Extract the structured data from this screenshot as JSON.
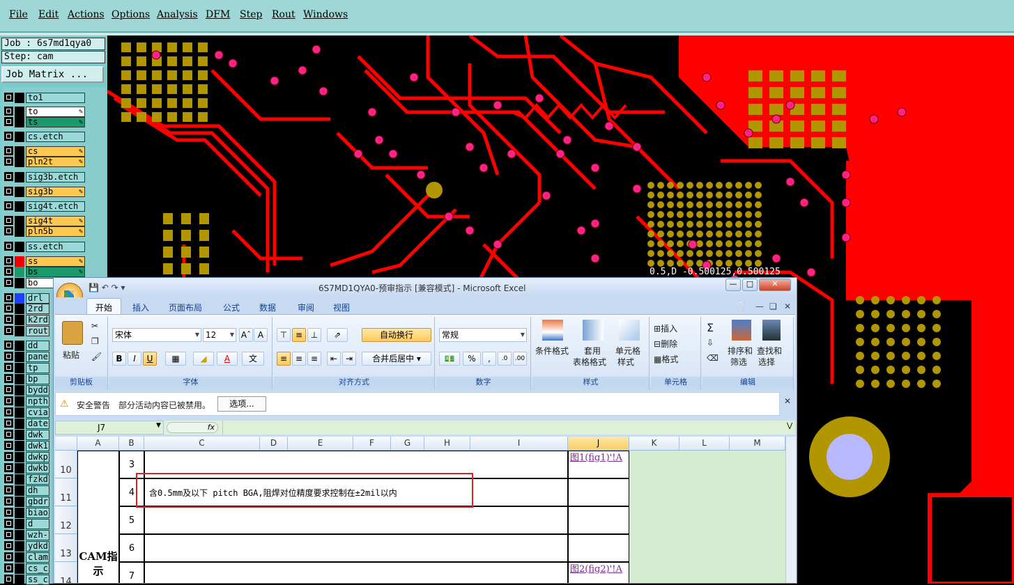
{
  "menubar": {
    "items": [
      "File",
      "Edit",
      "Actions",
      "Options",
      "Analysis",
      "DFM",
      "Step",
      "Rout",
      "Windows"
    ]
  },
  "job_panel": {
    "job_label": "Job : 6s7md1qya0",
    "step_label": "Step: cam",
    "job_matrix_button": "Job Matrix ..."
  },
  "layers": [
    {
      "name": "to1",
      "color": "#9bd8d8",
      "edit": false
    },
    {
      "name": "to",
      "color": "#ffffff",
      "edit": true
    },
    {
      "name": "ts",
      "color": "#1a9a6a",
      "edit": true
    },
    {
      "name": "cs.etch",
      "color": "#9bd8d8",
      "edit": false
    },
    {
      "name": "cs",
      "color": "#ffc850",
      "edit": true
    },
    {
      "name": "pln2t",
      "color": "#ffc850",
      "edit": true
    },
    {
      "name": "sig3b.etch",
      "color": "#9bd8d8",
      "edit": false
    },
    {
      "name": "sig3b",
      "color": "#ffc850",
      "edit": true
    },
    {
      "name": "sig4t.etch",
      "color": "#9bd8d8",
      "edit": false
    },
    {
      "name": "sig4t",
      "color": "#ffc850",
      "edit": true
    },
    {
      "name": "pln5b",
      "color": "#ffc850",
      "edit": true
    },
    {
      "name": "ss.etch",
      "color": "#9bd8d8",
      "edit": false
    },
    {
      "name": "ss",
      "color": "#ffc850",
      "edit": true
    },
    {
      "name": "bs",
      "color": "#1a9a6a",
      "edit": true
    },
    {
      "name": "bo",
      "color": "#ffffff",
      "edit": false
    },
    {
      "name": "drl",
      "color": "#9bd8d8",
      "edit": false
    },
    {
      "name": "2rd",
      "color": "#9bd8d8",
      "edit": false
    },
    {
      "name": "k2rd",
      "color": "#9bd8d8",
      "edit": false
    },
    {
      "name": "rout",
      "color": "#9bd8d8",
      "edit": false
    },
    {
      "name": "dd",
      "color": "#9bd8d8",
      "edit": false
    },
    {
      "name": "pane",
      "color": "#9bd8d8",
      "edit": false
    },
    {
      "name": "tp",
      "color": "#9bd8d8",
      "edit": false
    },
    {
      "name": "bp",
      "color": "#9bd8d8",
      "edit": false
    },
    {
      "name": "bydd",
      "color": "#9bd8d8",
      "edit": false
    },
    {
      "name": "npth",
      "color": "#9bd8d8",
      "edit": false
    },
    {
      "name": "cvia",
      "color": "#9bd8d8",
      "edit": false
    },
    {
      "name": "date",
      "color": "#9bd8d8",
      "edit": false
    },
    {
      "name": "dwk",
      "color": "#9bd8d8",
      "edit": false
    },
    {
      "name": "dwk1",
      "color": "#9bd8d8",
      "edit": false
    },
    {
      "name": "dwkp",
      "color": "#9bd8d8",
      "edit": false
    },
    {
      "name": "dwkb",
      "color": "#9bd8d8",
      "edit": false
    },
    {
      "name": "fzkd",
      "color": "#9bd8d8",
      "edit": false
    },
    {
      "name": "dh",
      "color": "#9bd8d8",
      "edit": false
    },
    {
      "name": "gbdr",
      "color": "#9bd8d8",
      "edit": false
    },
    {
      "name": "biao",
      "color": "#9bd8d8",
      "edit": false
    },
    {
      "name": "d",
      "color": "#9bd8d8",
      "edit": false
    },
    {
      "name": "wzh-",
      "color": "#9bd8d8",
      "edit": false
    },
    {
      "name": "ydkd",
      "color": "#9bd8d8",
      "edit": false
    },
    {
      "name": "clam",
      "color": "#9bd8d8",
      "edit": false
    },
    {
      "name": "cs_c",
      "color": "#9bd8d8",
      "edit": false
    },
    {
      "name": "ss_c",
      "color": "#9bd8d8",
      "edit": false
    }
  ],
  "canvas": {
    "coords_readout": "0.5,D -0.500125,0.500125",
    "colors": {
      "trace": "#ff0000",
      "pad": "#b29600",
      "via": "#ff2288"
    }
  },
  "excel": {
    "title": "6S7MD1QYA0-预审指示  [兼容模式] - Microsoft Excel",
    "tabs": [
      "开始",
      "插入",
      "页面布局",
      "公式",
      "数据",
      "审阅",
      "视图"
    ],
    "ribbon": {
      "clipboard": {
        "paste": "粘贴",
        "label": "剪贴板"
      },
      "font": {
        "name": "宋体",
        "size": "12",
        "label": "字体"
      },
      "align": {
        "wrap": "自动换行",
        "merge": "合并后居中",
        "label": "对齐方式"
      },
      "number": {
        "format": "常规",
        "label": "数字"
      },
      "styles": {
        "cond": "条件格式",
        "table1": "套用",
        "table2": "表格格式",
        "cell1": "单元格",
        "cell2": "样式",
        "label": "样式"
      },
      "cells": {
        "insert": "插入",
        "delete": "删除",
        "format": "格式",
        "label": "单元格"
      },
      "editing": {
        "sort1": "排序和",
        "sort2": "筛选",
        "find1": "查找和",
        "find2": "选择",
        "label": "编辑"
      }
    },
    "security": {
      "title": "安全警告",
      "message": "部分活动内容已被禁用。",
      "options": "选项..."
    },
    "namebox": "J7",
    "fx": "fx",
    "columns": [
      "A",
      "B",
      "C",
      "D",
      "E",
      "F",
      "G",
      "H",
      "I",
      "J",
      "K",
      "L",
      "M"
    ],
    "rows": [
      {
        "num": "10",
        "b": "3",
        "c": "",
        "j": "图1(fig1)'!A"
      },
      {
        "num": "11",
        "b": "4",
        "c": "含0.5mm及以下 pitch BGA,阻焊对位精度要求控制在±2mil以内",
        "j": ""
      },
      {
        "num": "12",
        "b": "5",
        "c": "",
        "j": ""
      },
      {
        "num": "13",
        "b": "6",
        "c": "",
        "j": ""
      },
      {
        "num": "14",
        "b": "7",
        "c": "",
        "j": "图2(fig2)'!A"
      }
    ],
    "merged_a": "CAM指示"
  }
}
